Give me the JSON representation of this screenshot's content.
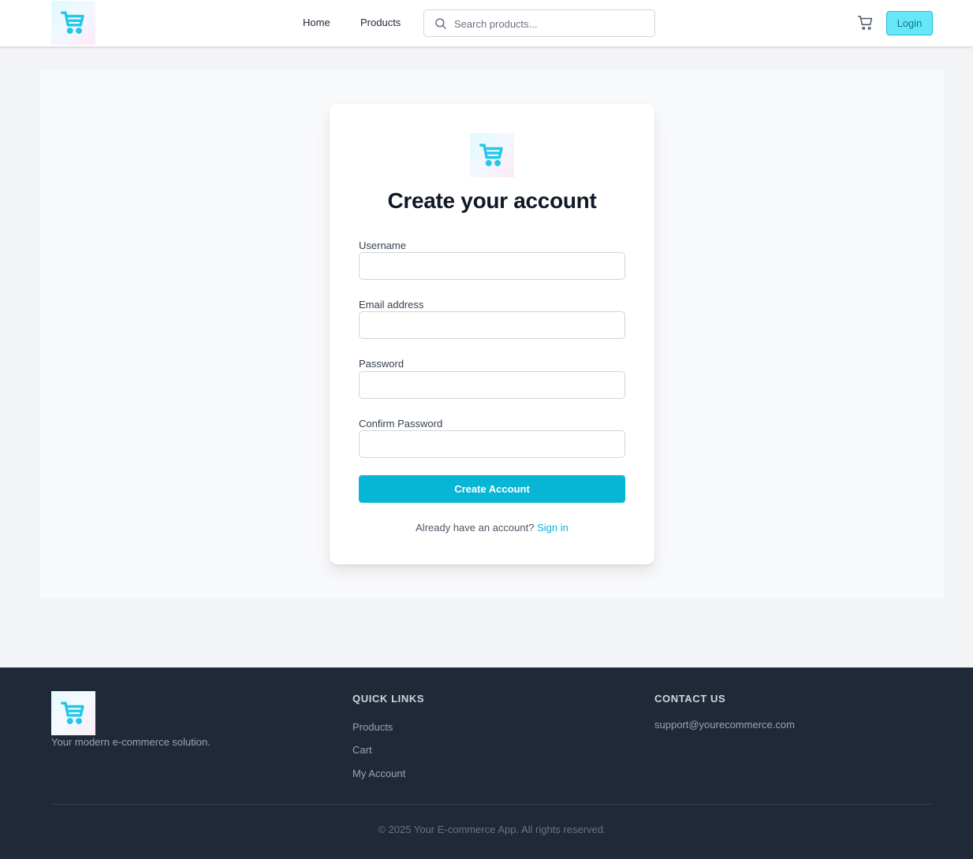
{
  "header": {
    "logo_icon": "shopping-cart-icon",
    "nav": [
      {
        "label": "Home"
      },
      {
        "label": "Products"
      }
    ],
    "search": {
      "placeholder": "Search products...",
      "value": "",
      "icon": "search-icon"
    },
    "cart_icon": "cart-icon",
    "login_label": "Login"
  },
  "form": {
    "logo_icon": "shopping-cart-icon",
    "title": "Create your account",
    "fields": [
      {
        "label": "Username",
        "value": ""
      },
      {
        "label": "Email address",
        "value": ""
      },
      {
        "label": "Password",
        "value": ""
      },
      {
        "label": "Confirm Password",
        "value": ""
      }
    ],
    "submit_label": "Create Account",
    "signin_prompt": "Already have an account?",
    "signin_link": "Sign in"
  },
  "footer": {
    "logo_icon": "shopping-cart-icon",
    "tagline": "Your modern e-commerce solution.",
    "quick_links_heading": "QUICK LINKS",
    "quick_links": [
      {
        "label": "Products"
      },
      {
        "label": "Cart"
      },
      {
        "label": "My Account"
      }
    ],
    "contact_heading": "CONTACT US",
    "email": "support@yourecommerce.com",
    "copyright": "© 2025 Your E-commerce App. All rights reserved."
  },
  "colors": {
    "accent": "#06b6d4",
    "login_bg": "#67e8f9",
    "footer_bg": "#1f2937",
    "page_bg": "#f3f4f6"
  }
}
